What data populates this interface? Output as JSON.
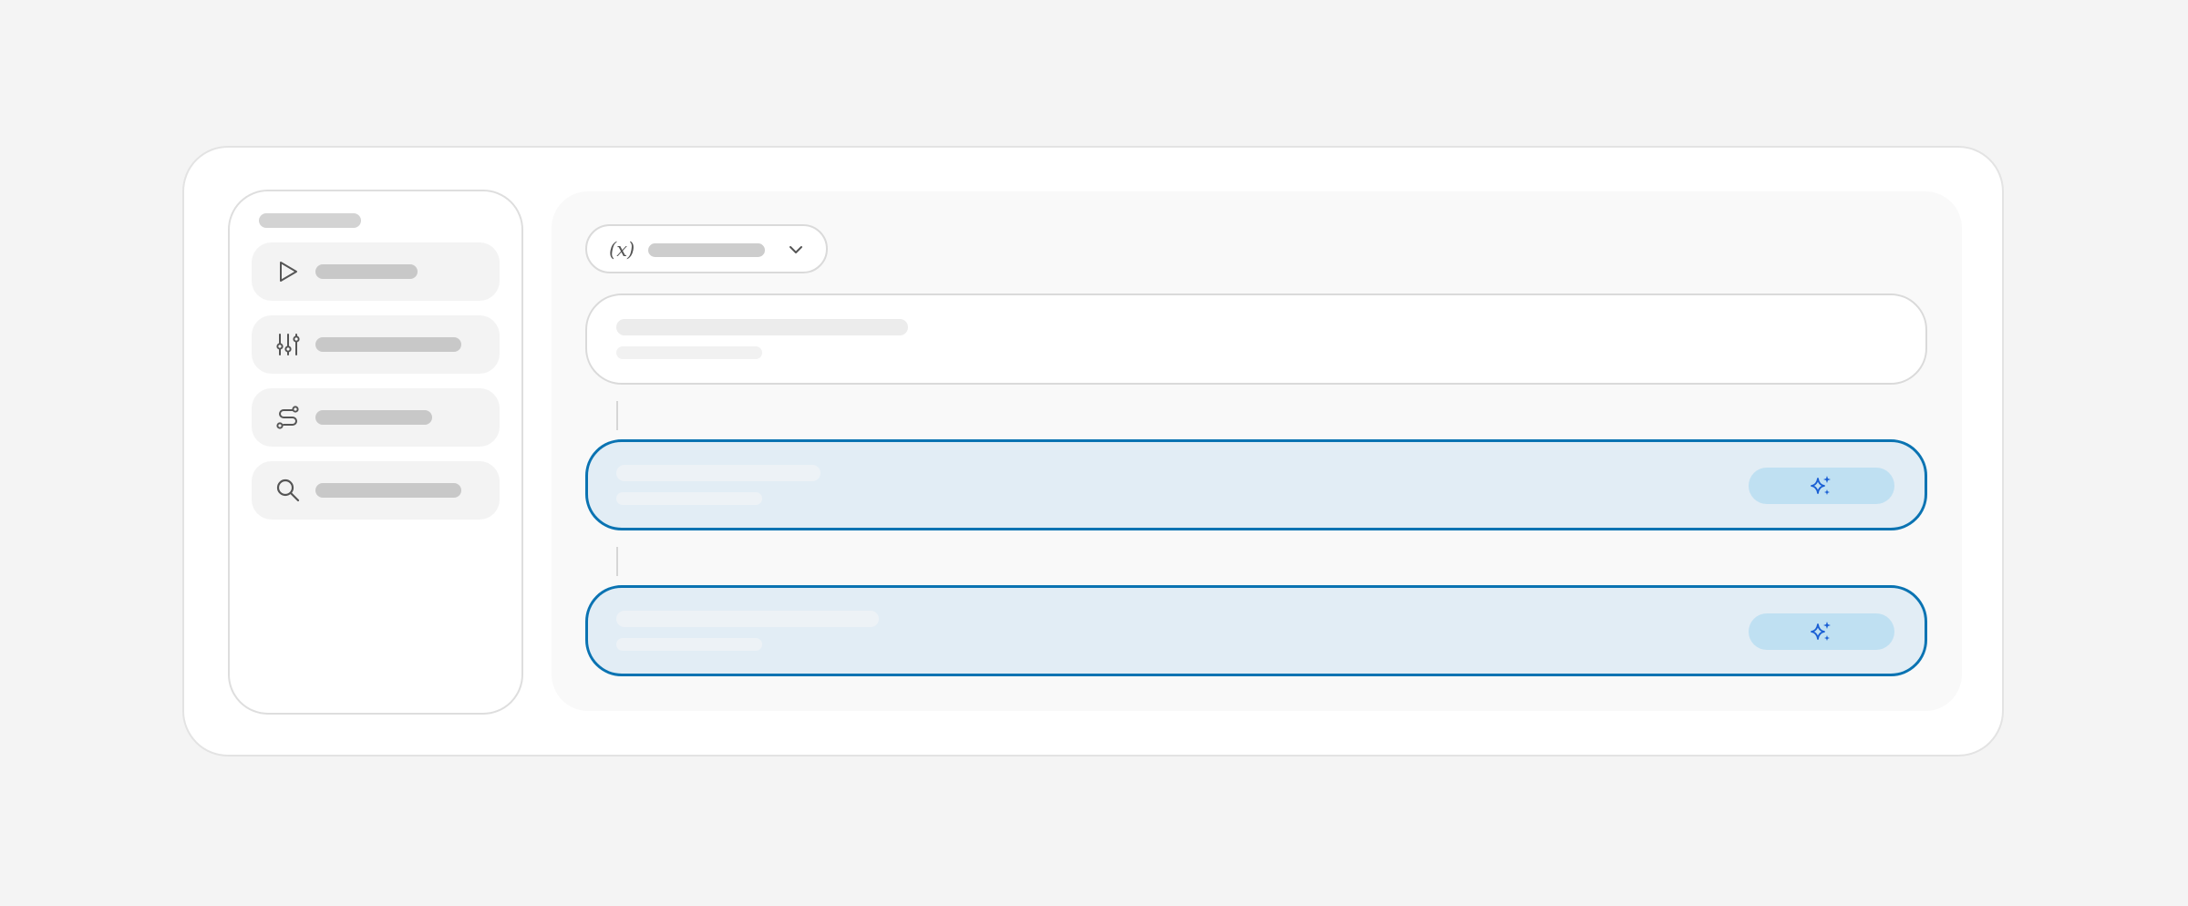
{
  "icons": {
    "variable_selector": "variable-icon",
    "variable_symbol": "(x)",
    "dropdown": "chevron-down-icon",
    "nav": [
      "play-icon",
      "sliders-icon",
      "route-icon",
      "search-icon"
    ],
    "ai_action": "sparkle-icon"
  },
  "colors": {
    "accent_border": "#0a73b2",
    "selected_fill": "#e2edf5",
    "ai_button_fill": "#bfe0f2",
    "sparkle": "#1a5fd4"
  }
}
